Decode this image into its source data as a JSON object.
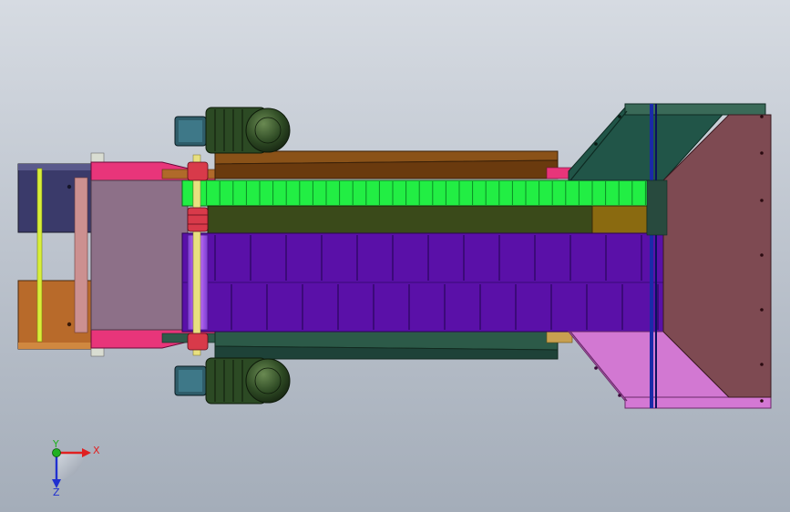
{
  "viewport": {
    "colors": {
      "bg_top": "#d6dbe2",
      "bg_bottom": "#a4adb9"
    }
  },
  "triad": {
    "x_label": "X",
    "y_label": "Y",
    "z_label": "Z",
    "colors": {
      "x": "#e02020",
      "y": "#20b020",
      "z": "#2030d0"
    }
  },
  "model": {
    "parts": [
      "left-bracket",
      "drive-roller",
      "chain-track",
      "conveyor-belt",
      "side-rail-top",
      "side-rail-bottom",
      "motor-top",
      "motor-bottom",
      "discharge-hopper"
    ],
    "colors": {
      "bracket_navy": "#3a3a6a",
      "bracket_orange": "#b86a2a",
      "frame_pink": "#e8357a",
      "belt_purple": "#5a10a8",
      "chain_green": "#22ee44",
      "rail_brown": "#8a5218",
      "motor_green": "#2c4a24",
      "hopper_teal": "#215548",
      "hopper_maroon": "#7e4a52",
      "hopper_pink": "#d278d2"
    }
  }
}
